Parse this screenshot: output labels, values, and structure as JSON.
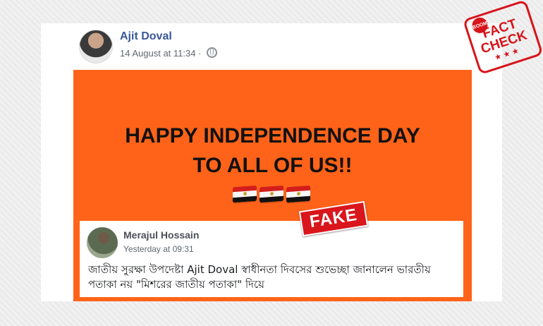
{
  "post": {
    "author": "Ajit Doval",
    "date": "14 August at 11:34 ·",
    "privacy_icon": "globe-icon"
  },
  "image": {
    "headline_line1": "HAPPY INDEPENDENCE DAY",
    "headline_line2": "TO ALL OF US!!",
    "flags": [
      "egypt-flag",
      "egypt-flag",
      "egypt-flag"
    ],
    "background_color": "#ff6319"
  },
  "fake_label": "FAKE",
  "shared_post": {
    "author": "Merajul Hossain",
    "time": "Yesterday at 09:31",
    "text": "জাতীয় সুরক্ষা উপদেষ্টা Ajit Doval স্বাধীনতা দিবসের শুভেচ্ছা জানালেন ভারতীয় পতাকা নয় \"মিশরের জাতীয় পতাকা\" দিয়ে"
  },
  "stamp": {
    "brand": "BOOM",
    "line1": "FACT",
    "line2": "CHECK",
    "stars": "★★★",
    "color": "#d7141a"
  }
}
